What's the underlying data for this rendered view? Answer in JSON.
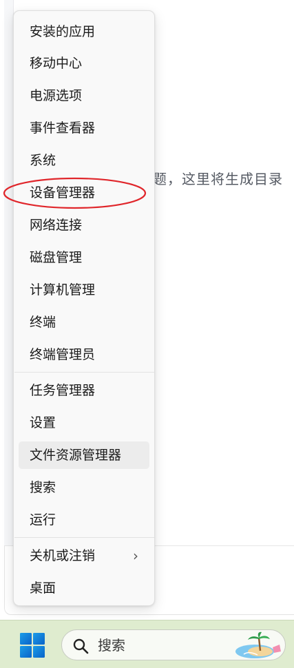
{
  "document": {
    "hint_text": "题，这里将生成目录"
  },
  "context_menu": {
    "groups": [
      [
        "安装的应用",
        "移动中心",
        "电源选项",
        "事件查看器",
        "系统",
        "设备管理器",
        "网络连接",
        "磁盘管理",
        "计算机管理",
        "终端",
        "终端管理员"
      ],
      [
        "任务管理器",
        "设置",
        "文件资源管理器",
        "搜索",
        "运行"
      ],
      [
        "关机或注销",
        "桌面"
      ]
    ],
    "highlighted_item": "文件资源管理器",
    "circled_item": "设备管理器",
    "submenu_item": "关机或注销",
    "annotation_color": "#e0262b"
  },
  "taskbar": {
    "background": "#dfeccf",
    "start_icon": "windows-logo-icon",
    "search": {
      "icon": "search-icon",
      "label": "搜索"
    }
  }
}
